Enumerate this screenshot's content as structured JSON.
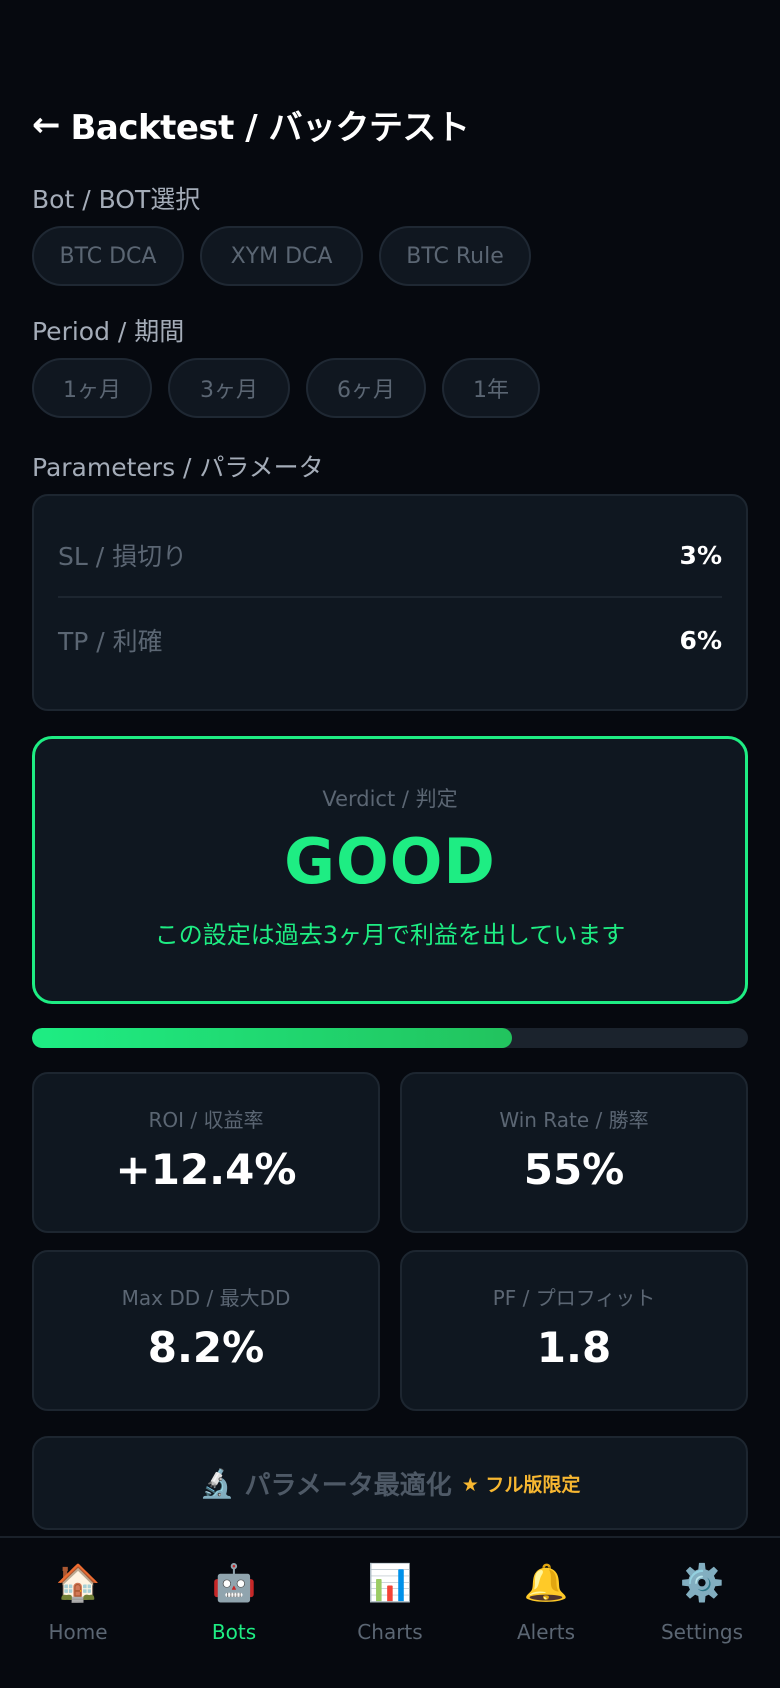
{
  "header": {
    "back_icon": "←",
    "title": "Backtest / バックテスト"
  },
  "bot_section": {
    "label": "Bot / BOT選択",
    "chips": [
      {
        "label": "BTC DCA",
        "active": true
      },
      {
        "label": "XYM DCA",
        "active": false
      },
      {
        "label": "BTC Rule",
        "active": false
      }
    ]
  },
  "period_section": {
    "label": "Period / 期間",
    "chips": [
      {
        "label": "1ヶ月",
        "active": false
      },
      {
        "label": "3ヶ月",
        "active": true
      },
      {
        "label": "6ヶ月",
        "active": false
      },
      {
        "label": "1年",
        "active": false
      }
    ]
  },
  "params_section": {
    "label": "Parameters / パラメータ",
    "rows": [
      {
        "label": "SL / 損切り",
        "value": "3%"
      },
      {
        "label": "TP / 利確",
        "value": "6%"
      }
    ]
  },
  "verdict": {
    "label": "Verdict / 判定",
    "value": "GOOD",
    "description": "この設定は過去3ヶ月で利益を出しています",
    "color": "#1eed83"
  },
  "progress": {
    "fraction": 0.67
  },
  "stats": [
    {
      "label": "ROI / 収益率",
      "value": "+12.4%"
    },
    {
      "label": "Win Rate / 勝率",
      "value": "55%"
    },
    {
      "label": "Max DD / 最大DD",
      "value": "8.2%"
    },
    {
      "label": "PF / プロフィット",
      "value": "1.8"
    }
  ],
  "optimize": {
    "icon": "microscope-icon",
    "icon_glyph": "🔬",
    "label": "パラメータ最適化",
    "badge": "★ フル版限定"
  },
  "nav": {
    "items": [
      {
        "label": "Home",
        "icon": "home-icon",
        "glyph": "🏠",
        "active": false
      },
      {
        "label": "Bots",
        "icon": "robot-icon",
        "glyph": "🤖",
        "active": true
      },
      {
        "label": "Charts",
        "icon": "chart-icon",
        "glyph": "📊",
        "active": false
      },
      {
        "label": "Alerts",
        "icon": "bell-icon",
        "glyph": "🔔",
        "active": false
      },
      {
        "label": "Settings",
        "icon": "gear-icon",
        "glyph": "⚙️",
        "active": false
      }
    ]
  },
  "colors": {
    "accent": "#1eed83",
    "background": "#06090f",
    "card": "#0f1720",
    "badge": "#f7b731"
  }
}
